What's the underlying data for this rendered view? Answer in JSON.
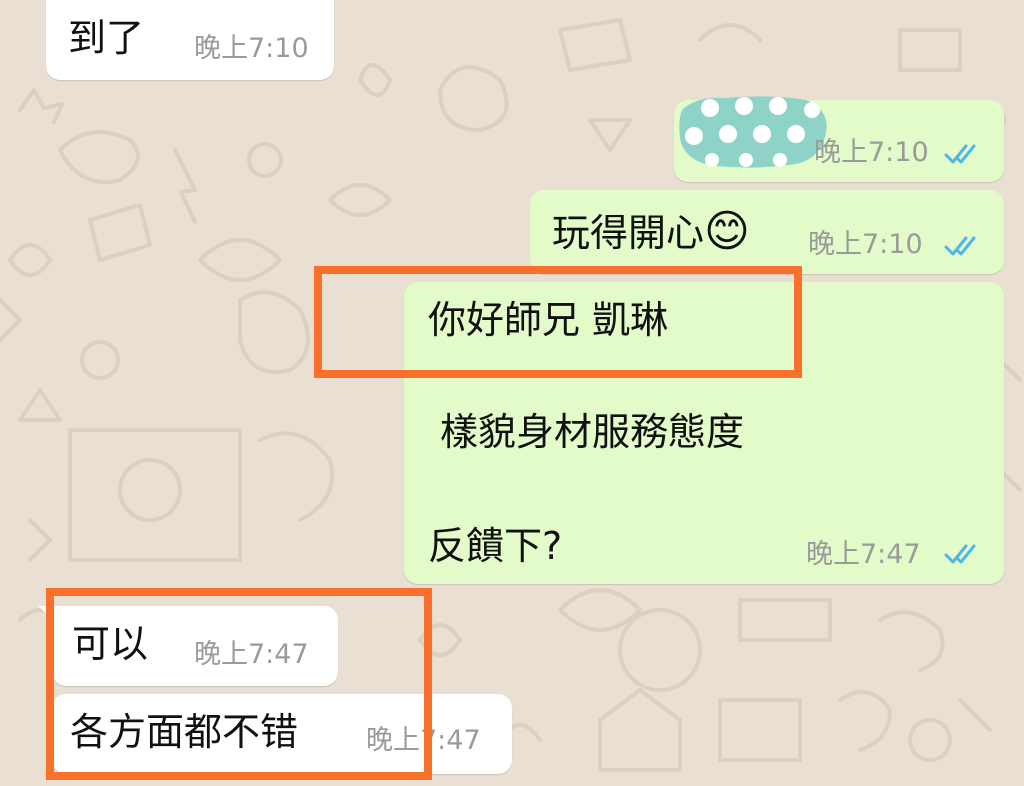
{
  "messages": [
    {
      "id": "m1",
      "direction": "incoming",
      "text": "到了",
      "time": "晚上7:10"
    },
    {
      "id": "m2",
      "direction": "outgoing",
      "text": "",
      "time": "晚上7:10",
      "status": "read",
      "has_redacted_sticker": true
    },
    {
      "id": "m3",
      "direction": "outgoing",
      "text": "玩得開心",
      "emoji": "😊",
      "time": "晚上7:10",
      "status": "read"
    },
    {
      "id": "m4",
      "direction": "outgoing",
      "lines": [
        "你好師兄  凱琳",
        "樣貌身材服務態度",
        "反饋下?"
      ],
      "time": "晚上7:47",
      "status": "read"
    },
    {
      "id": "m5",
      "direction": "incoming",
      "text": "可以",
      "time": "晚上7:47"
    },
    {
      "id": "m6",
      "direction": "incoming",
      "text": "各方面都不错",
      "time": "晚上7:47"
    }
  ],
  "colors": {
    "wallpaper": "#e9dfd2",
    "incoming_bubble": "#ffffff",
    "outgoing_bubble": "#e3fbc9",
    "read_ticks": "#4fb6ec",
    "highlight": "#f96f2c",
    "redaction": "#8fd3c8"
  },
  "icons": {
    "read_receipt": "double-check-icon"
  }
}
